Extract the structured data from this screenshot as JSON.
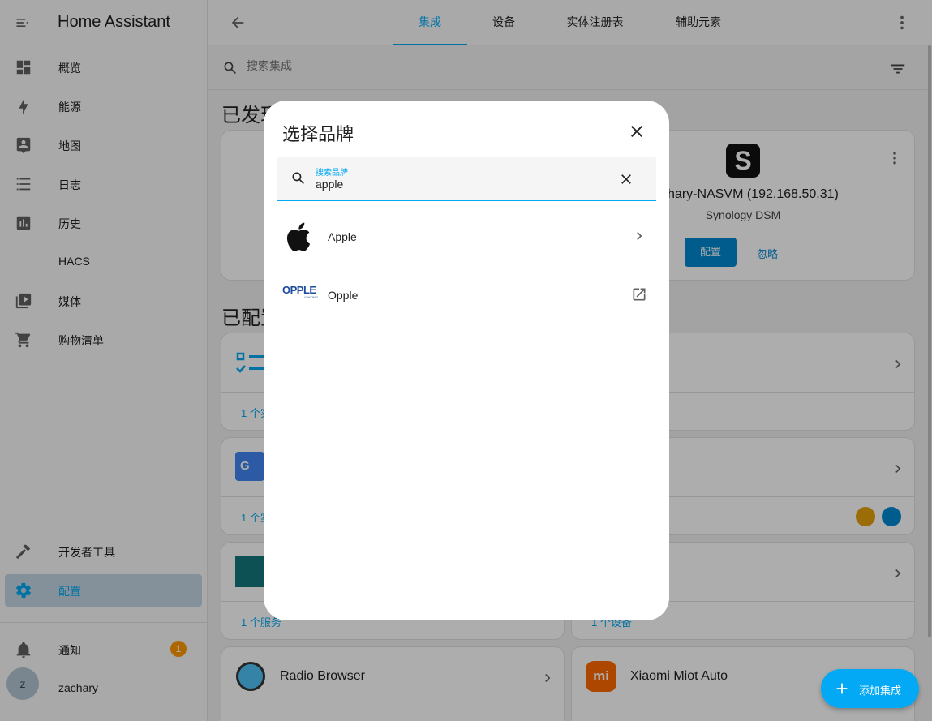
{
  "app": {
    "title": "Home Assistant"
  },
  "sidebar": {
    "items": [
      {
        "label": "概览",
        "icon": "dashboard-icon"
      },
      {
        "label": "能源",
        "icon": "lightning-icon"
      },
      {
        "label": "地图",
        "icon": "map-account-icon"
      },
      {
        "label": "日志",
        "icon": "list-icon"
      },
      {
        "label": "历史",
        "icon": "chart-box-icon"
      },
      {
        "label": "HACS",
        "icon": "hacs-icon"
      },
      {
        "label": "媒体",
        "icon": "play-box-icon"
      },
      {
        "label": "购物清单",
        "icon": "cart-icon"
      }
    ],
    "dev_tools": "开发者工具",
    "settings": "配置",
    "notifications": {
      "label": "通知",
      "count": "1"
    },
    "user": {
      "name": "zachary",
      "initial": "z"
    }
  },
  "topbar": {
    "tabs": [
      "集成",
      "设备",
      "实体注册表",
      "辅助元素"
    ],
    "active_tab": "集成"
  },
  "search": {
    "placeholder": "搜索集成"
  },
  "sections": {
    "discovered": "已发现",
    "configured": "已配置"
  },
  "discovered_card": {
    "title": "zachary-NASVM (192.168.50.31)",
    "subtitle": "Synology DSM",
    "configure": "配置",
    "ignore": "忽略"
  },
  "cards": {
    "c1_foot": "1 个实体",
    "c2_foot": "1 个实体",
    "c3_foot": "1 个服务",
    "c4_foot": "1 个设备",
    "radio_browser": "Radio Browser",
    "xiaomi": "Xiaomi Miot Auto"
  },
  "dialog": {
    "title": "选择品牌",
    "search_label": "搜索品牌",
    "search_value": "apple",
    "results": [
      {
        "name": "Apple",
        "logo": "apple-logo",
        "action": "chevron-right-icon"
      },
      {
        "name": "Opple",
        "logo": "opple-logo",
        "logo_text": "OPPLE",
        "logo_sub": "LIGHTING",
        "action": "open-in-new-icon"
      }
    ]
  },
  "fab": {
    "label": "添加集成"
  },
  "colors": {
    "accent": "#03a9f4",
    "badge": "#ff9800",
    "active_bg": "#c3d6e3"
  }
}
